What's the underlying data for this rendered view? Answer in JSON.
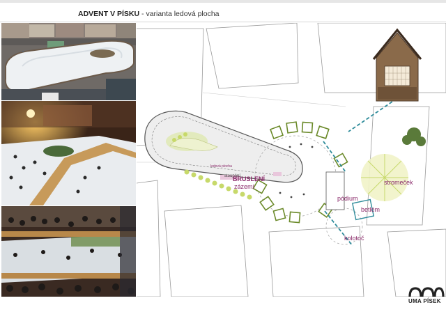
{
  "header": {
    "title_bold": "ADVENT V PÍSKU",
    "title_rest": " - varianta ledová plocha"
  },
  "photos": [
    {
      "alt_role": "aerial-rink-photo"
    },
    {
      "alt_role": "night-rink-photo"
    },
    {
      "alt_role": "crowd-rink-photo"
    }
  ],
  "plan": {
    "labels": {
      "rink_area": "ledová plocha",
      "skating_line1": "BRUSLENÍ",
      "skating_line2": "zázemí",
      "tree": "stromeček",
      "stage": "pódium",
      "nativity": "betlém",
      "carousel": "kolotoč",
      "small_tag": "stoupání"
    },
    "colors": {
      "label": "#8a2a6a",
      "arrow": "#2e8b9a",
      "stall_fill": "#8cb33a",
      "greenery": "#c7d96a"
    }
  },
  "footer": {
    "brand": "UMA PÍSEK"
  }
}
